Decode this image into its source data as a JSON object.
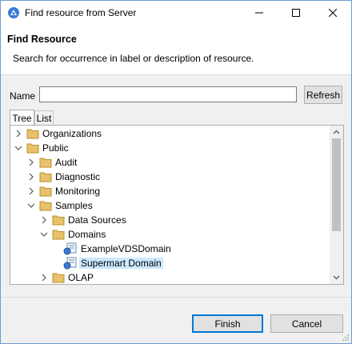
{
  "window": {
    "title": "Find resource from Server",
    "minimize_icon": "minimize-icon",
    "maximize_icon": "maximize-icon",
    "close_icon": "close-icon"
  },
  "header": {
    "title": "Find Resource",
    "description": "Search for occurrence in label or description of resource."
  },
  "search": {
    "name_label": "Name",
    "name_value": "",
    "refresh_label": "Refresh"
  },
  "tabs": [
    {
      "label": "Tree",
      "active": true
    },
    {
      "label": "List",
      "active": false
    }
  ],
  "tree": {
    "rows": [
      {
        "label": "Organizations",
        "expanded": false,
        "type": "folder"
      },
      {
        "label": "Public",
        "expanded": true,
        "type": "folder"
      },
      {
        "label": "Audit",
        "expanded": false,
        "type": "folder"
      },
      {
        "label": "Diagnostic",
        "expanded": false,
        "type": "folder"
      },
      {
        "label": "Monitoring",
        "expanded": false,
        "type": "folder"
      },
      {
        "label": "Samples",
        "expanded": true,
        "type": "folder"
      },
      {
        "label": "Data Sources",
        "expanded": false,
        "type": "folder"
      },
      {
        "label": "Domains",
        "expanded": true,
        "type": "folder"
      },
      {
        "label": "ExampleVDSDomain",
        "type": "domain"
      },
      {
        "label": "Supermart Domain",
        "type": "domain",
        "selected": true
      },
      {
        "label": "OLAP",
        "expanded": false,
        "type": "folder"
      }
    ]
  },
  "footer": {
    "finish_label": "Finish",
    "cancel_label": "Cancel"
  },
  "colors": {
    "selection": "#cce8ff",
    "folder": "#e8c26a",
    "accent": "#0078d7"
  }
}
